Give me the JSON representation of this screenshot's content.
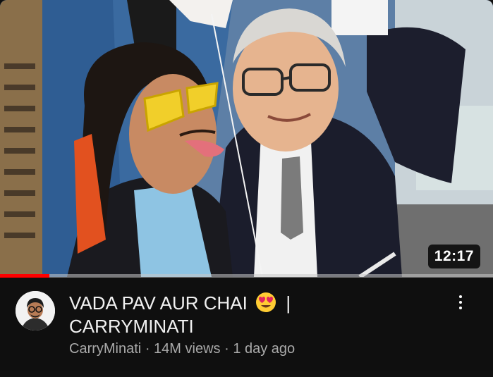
{
  "video": {
    "title_part1": "VADA PAV AUR CHAI",
    "title_emoji": "heart-eyes-emoji",
    "title_separator": "|",
    "title_part2": "CARRYMINATI",
    "duration": "12:17",
    "progress_fraction": 0.1,
    "channel": "CarryMinati",
    "views": "14M views",
    "age": "1 day ago",
    "separator": "·"
  },
  "colors": {
    "background": "#0f0f0f",
    "progress": "#ff0000",
    "title": "#f1f1f1",
    "meta": "#aaaaaa"
  },
  "icons": {
    "menu": "more-vert-icon",
    "avatar": "channel-avatar"
  }
}
